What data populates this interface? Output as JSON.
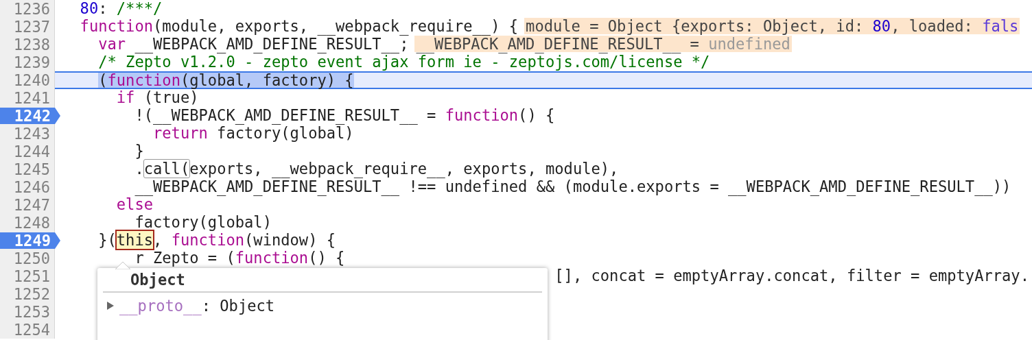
{
  "lines": [
    {
      "number": "1236",
      "breakpoint": false,
      "current": false,
      "selected_text": false,
      "tokens": [
        {
          "text": "  80",
          "kind": "number"
        },
        {
          "text": ": ",
          "kind": "plain"
        },
        {
          "text": "/***/",
          "kind": "comment"
        }
      ]
    },
    {
      "number": "1237",
      "breakpoint": false,
      "current": false,
      "selected_text": false,
      "tokens": [
        {
          "text": "  function",
          "kind": "keyword"
        },
        {
          "text": "(module, exports, __webpack_require__) {",
          "kind": "plain"
        }
      ],
      "inline_value": [
        {
          "text": "module = Object {exports: Object, id: ",
          "kind": "plain"
        },
        {
          "text": "80",
          "kind": "number"
        },
        {
          "text": ", loaded: ",
          "kind": "plain"
        },
        {
          "text": "fals",
          "kind": "literal"
        }
      ]
    },
    {
      "number": "1238",
      "breakpoint": false,
      "current": false,
      "selected_text": false,
      "tokens": [
        {
          "text": "    var",
          "kind": "keyword"
        },
        {
          "text": " __WEBPACK_AMD_DEFINE_RESULT__;",
          "kind": "plain"
        }
      ],
      "inline_value": [
        {
          "text": "__WEBPACK_AMD_DEFINE_RESULT__ = ",
          "kind": "plain"
        },
        {
          "text": "undefined",
          "kind": "undefined"
        }
      ]
    },
    {
      "number": "1239",
      "breakpoint": false,
      "current": false,
      "selected_text": false,
      "tokens": [
        {
          "text": "    /* Zepto v1.2.0 - zepto event ajax form ie - zeptojs.com/license */",
          "kind": "comment"
        }
      ]
    },
    {
      "number": "1240",
      "breakpoint": false,
      "current": true,
      "selected_text": true,
      "tokens": [
        {
          "text": "    (",
          "kind": "plain"
        },
        {
          "text": "function",
          "kind": "keyword"
        },
        {
          "text": "(global, factory) {",
          "kind": "plain"
        }
      ]
    },
    {
      "number": "1241",
      "breakpoint": false,
      "current": false,
      "selected_text": false,
      "tokens": [
        {
          "text": "      if",
          "kind": "keyword"
        },
        {
          "text": " (true)",
          "kind": "plain"
        }
      ]
    },
    {
      "number": "1242",
      "breakpoint": true,
      "current": false,
      "selected_text": false,
      "tokens": [
        {
          "text": "        !(__WEBPACK_AMD_DEFINE_RESULT__ = ",
          "kind": "plain"
        },
        {
          "text": "function",
          "kind": "keyword"
        },
        {
          "text": "() {",
          "kind": "plain"
        }
      ]
    },
    {
      "number": "1243",
      "breakpoint": false,
      "current": false,
      "selected_text": false,
      "tokens": [
        {
          "text": "          return",
          "kind": "keyword"
        },
        {
          "text": " factory(global)",
          "kind": "plain"
        }
      ]
    },
    {
      "number": "1244",
      "breakpoint": false,
      "current": false,
      "selected_text": false,
      "tokens": [
        {
          "text": "        }",
          "kind": "plain"
        }
      ]
    },
    {
      "number": "1245",
      "breakpoint": false,
      "current": false,
      "selected_text": false,
      "tokens": [
        {
          "text": "        .",
          "kind": "plain"
        },
        {
          "text": "call(",
          "kind": "boxed"
        },
        {
          "text": "exports, __webpack_require__, exports, module),",
          "kind": "plain"
        }
      ]
    },
    {
      "number": "1246",
      "breakpoint": false,
      "current": false,
      "selected_text": false,
      "tokens": [
        {
          "text": "        __WEBPACK_AMD_DEFINE_RESULT__ !== undefined && (module.exports = __WEBPACK_AMD_DEFINE_RESULT__))",
          "kind": "plain"
        }
      ]
    },
    {
      "number": "1247",
      "breakpoint": false,
      "current": false,
      "selected_text": false,
      "tokens": [
        {
          "text": "      else",
          "kind": "keyword"
        }
      ]
    },
    {
      "number": "1248",
      "breakpoint": false,
      "current": false,
      "selected_text": false,
      "tokens": [
        {
          "text": "        factory(global)",
          "kind": "plain"
        }
      ]
    },
    {
      "number": "1249",
      "breakpoint": true,
      "current": false,
      "selected_text": false,
      "tokens": [
        {
          "text": "    }(",
          "kind": "plain"
        },
        {
          "text": "this",
          "kind": "hover-target"
        },
        {
          "text": ", ",
          "kind": "plain"
        },
        {
          "text": "function",
          "kind": "keyword"
        },
        {
          "text": "(window) {",
          "kind": "plain"
        }
      ]
    },
    {
      "number": "1250",
      "breakpoint": false,
      "current": false,
      "selected_text": false,
      "tokens": [
        {
          "text": "        r Zepto = (",
          "kind": "plain"
        },
        {
          "text": "function",
          "kind": "keyword"
        },
        {
          "text": "() {",
          "kind": "plain"
        }
      ]
    },
    {
      "number": "1251",
      "breakpoint": false,
      "current": false,
      "selected_text": false,
      "tokens": [
        {
          "text": "                                                      [], concat = emptyArray.concat, filter = emptyArray.",
          "kind": "plain"
        }
      ]
    },
    {
      "number": "1252",
      "breakpoint": false,
      "current": false
    },
    {
      "number": "1253",
      "breakpoint": false,
      "current": false
    },
    {
      "number": "1254",
      "breakpoint": false,
      "current": false
    }
  ],
  "popover": {
    "title": "Object",
    "rows": [
      {
        "expanded": false,
        "key": "__proto__",
        "value": ": Object"
      }
    ]
  }
}
